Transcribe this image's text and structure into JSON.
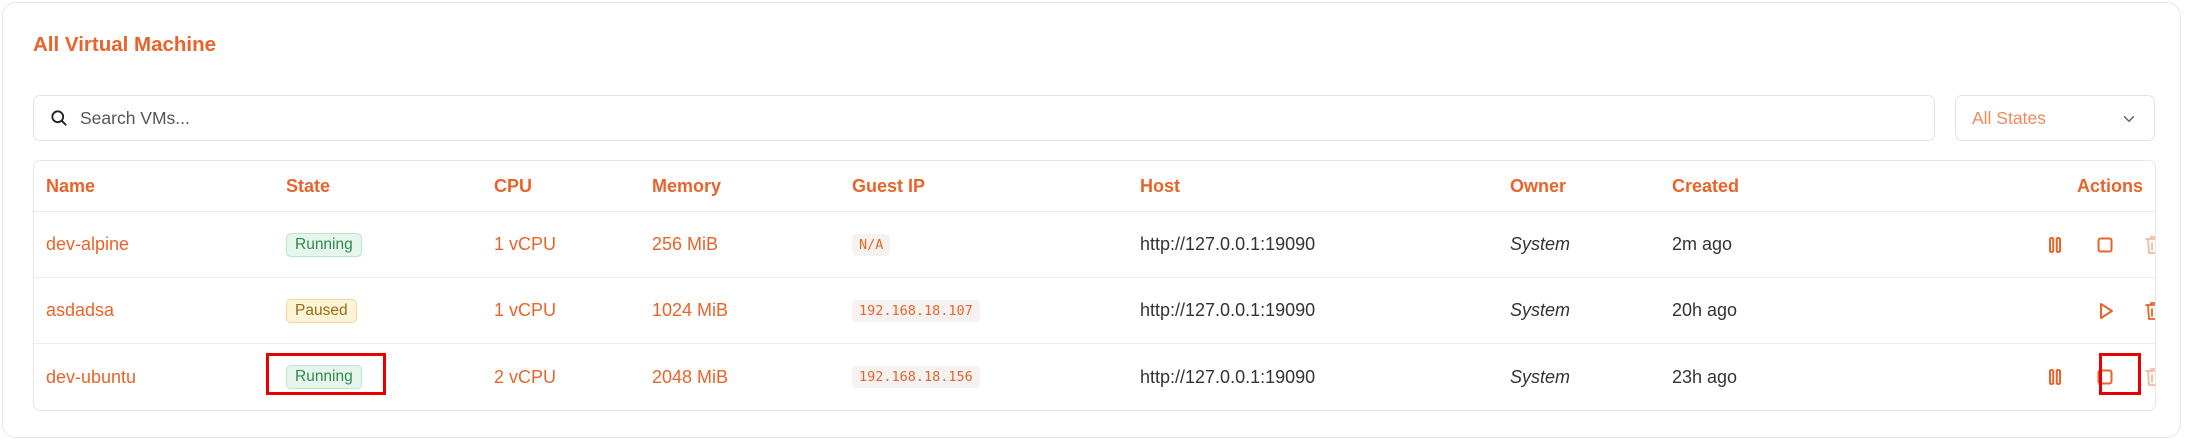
{
  "title": "All Virtual Machine",
  "search": {
    "placeholder": "Search VMs..."
  },
  "filter": {
    "selected": "All States"
  },
  "table": {
    "headers": {
      "name": "Name",
      "state": "State",
      "cpu": "CPU",
      "memory": "Memory",
      "guest_ip": "Guest IP",
      "host": "Host",
      "owner": "Owner",
      "created": "Created",
      "actions": "Actions"
    },
    "rows": [
      {
        "name": "dev-alpine",
        "state": "Running",
        "cpu": "1 vCPU",
        "memory": "256 MiB",
        "guest_ip": "N/A",
        "host": "http://127.0.0.1:19090",
        "owner": "System",
        "created": "2m ago"
      },
      {
        "name": "asdadsa",
        "state": "Paused",
        "cpu": "1 vCPU",
        "memory": "1024 MiB",
        "guest_ip": "192.168.18.107",
        "host": "http://127.0.0.1:19090",
        "owner": "System",
        "created": "20h ago"
      },
      {
        "name": "dev-ubuntu",
        "state": "Running",
        "cpu": "2 vCPU",
        "memory": "2048 MiB",
        "guest_ip": "192.168.18.156",
        "host": "http://127.0.0.1:19090",
        "owner": "System",
        "created": "23h ago"
      }
    ]
  },
  "icons": {
    "search": "search-icon",
    "chevron": "chevron-down-icon",
    "pause": "pause-icon",
    "stop": "stop-icon",
    "play": "play-icon",
    "delete": "trash-icon"
  },
  "colors": {
    "accent": "#e8642a",
    "running_bg": "#e6f6ec",
    "running_text": "#2f8a4c",
    "paused_bg": "#fdf3d6",
    "paused_text": "#9a6b10",
    "highlight": "#e60000"
  }
}
